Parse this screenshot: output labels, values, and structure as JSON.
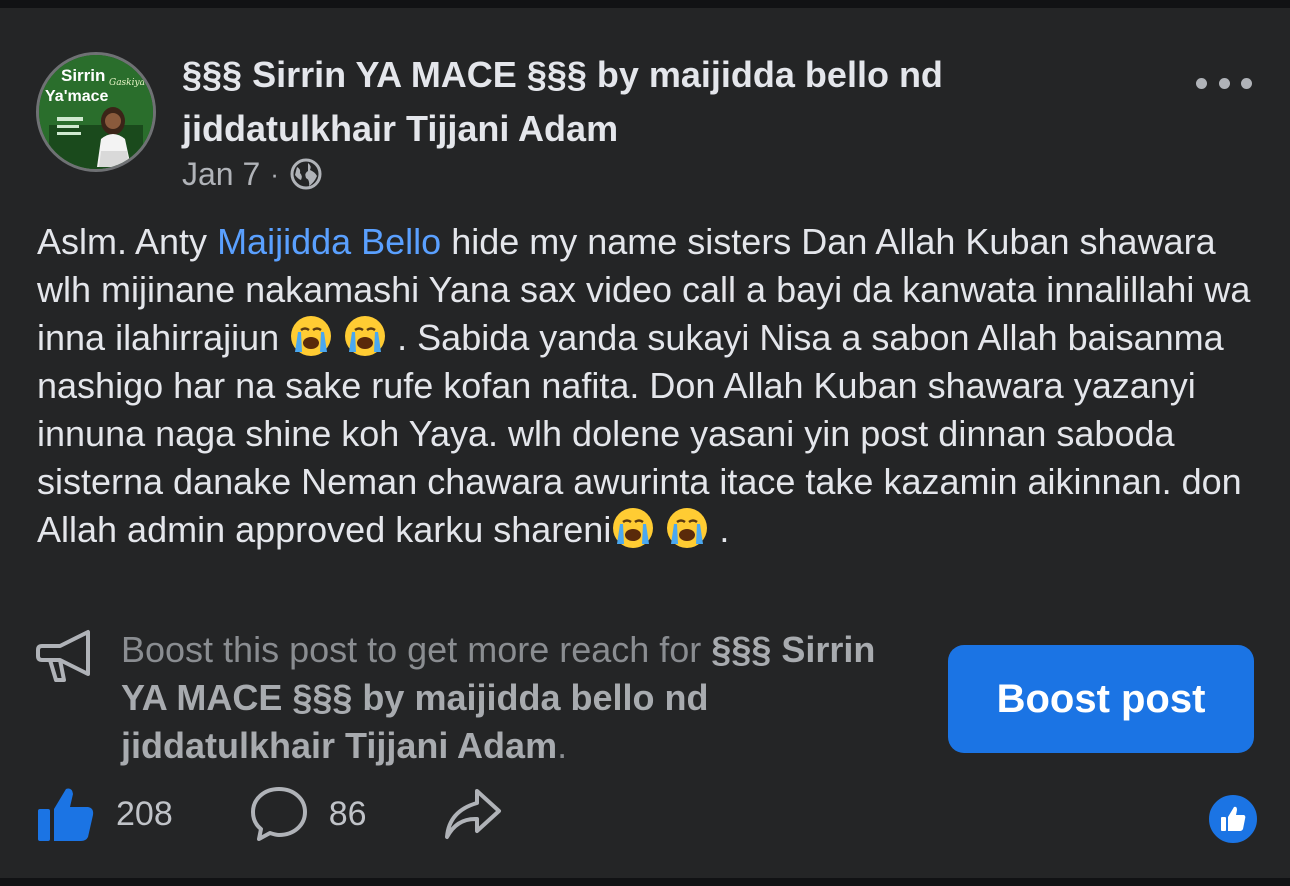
{
  "post": {
    "author": "§§§ Sirrin YA MACE §§§ by maijidda bello  nd jiddatulkhair Tijjani Adam",
    "date": "Jan 7",
    "separator": "·",
    "privacy_icon": "globe-icon",
    "more_icon": "more-horizontal-icon",
    "avatar_text": {
      "line1": "Sirrin",
      "line2": "Ya'mace",
      "script": "Gaskiya"
    },
    "body": {
      "p1": "Aslm. Anty ",
      "mention": "Maijidda Bello",
      "p2": " hide my name sisters Dan Allah Kuban shawara wlh mijinane nakamashi Yana sax video call a bayi da kanwata innalillahi wa inna ilahirrajiun ",
      "p3": " . Sabida yanda sukayi Nisa a sabon Allah baisanma nashigo har na sake rufe kofan nafita. Don Allah Kuban shawara yazanyi innuna naga shine koh Yaya. wlh dolene yasani yin post dinnan saboda sisterna danake Neman chawara awurinta itace take kazamin aikinnan. don Allah admin approved karku shareni",
      "p4": " .",
      "emoji": "loudly-crying-face"
    }
  },
  "boost": {
    "prefix": "Boost this post to get more reach for ",
    "page_name": "§§§ Sirrin YA MACE §§§ by maijidda bello  nd jiddatulkhair Tijjani Adam",
    "suffix": ".",
    "button_label": "Boost post",
    "icon": "megaphone-icon"
  },
  "actions": {
    "likes": "208",
    "comments": "86",
    "like_icon": "thumbs-up-icon",
    "comment_icon": "comment-bubble-icon",
    "share_icon": "share-arrow-icon",
    "reaction_icon": "like-reaction-icon"
  },
  "colors": {
    "background": "#242526",
    "accent": "#1b74e4",
    "mention": "#5aa0ff",
    "text": "#e4e6eb",
    "muted": "#b0b3b8"
  }
}
